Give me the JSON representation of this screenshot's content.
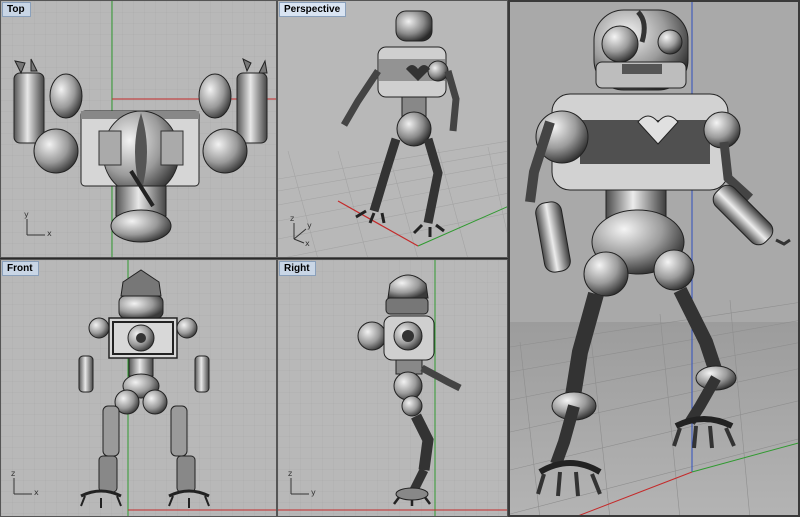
{
  "viewports": {
    "top": {
      "label": "Top"
    },
    "perspective": {
      "label": "Perspective"
    },
    "front": {
      "label": "Front"
    },
    "right": {
      "label": "Right"
    }
  },
  "axes": {
    "top": {
      "x": "x",
      "y": "y"
    },
    "front": {
      "x": "x",
      "z": "z"
    },
    "right": {
      "y": "y",
      "z": "z"
    },
    "perspective": {
      "x": "x",
      "y": "y",
      "z": "z"
    }
  },
  "colors": {
    "viewport_bg": "#b8b8b8",
    "grid_line": "#a6a6a6",
    "grid_major": "#9a9a9a",
    "x_axis": "#c42a2a",
    "y_axis": "#2f9a2f",
    "model_light": "#e4e4e4",
    "model_dark": "#3a3a3a",
    "label_bg": "#c9d6e6"
  }
}
